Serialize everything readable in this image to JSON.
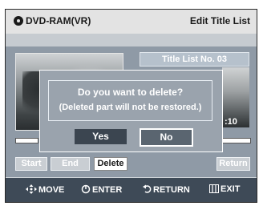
{
  "header": {
    "disc_label": "DVD-RAM(VR)",
    "screen_title": "Edit Title List",
    "disc_icon": "disc-icon"
  },
  "preview": {
    "title_list_label": "Title List No. 03",
    "time_fragment": ":10"
  },
  "dialog": {
    "message": "Do you want to delete?",
    "note": "(Deleted part will not be restored.)",
    "yes_label": "Yes",
    "no_label": "No",
    "selected": "No"
  },
  "edit_buttons": {
    "start_label": "Start",
    "end_label": "End",
    "delete_label": "Delete",
    "return_label": "Return",
    "active": "Delete"
  },
  "footer": {
    "move_label": "MOVE",
    "move_icon": "move-arrows-icon",
    "enter_label": "ENTER",
    "enter_icon": "enter-icon",
    "return_label": "RETURN",
    "return_icon": "return-icon",
    "exit_label": "EXIT",
    "exit_icon": "exit-icon"
  },
  "colors": {
    "header_bg": "#e3e3e3",
    "panel_bg": "#8f9aa6",
    "footer_bg": "#3e4a57",
    "selected_bg": "#3b4550"
  }
}
